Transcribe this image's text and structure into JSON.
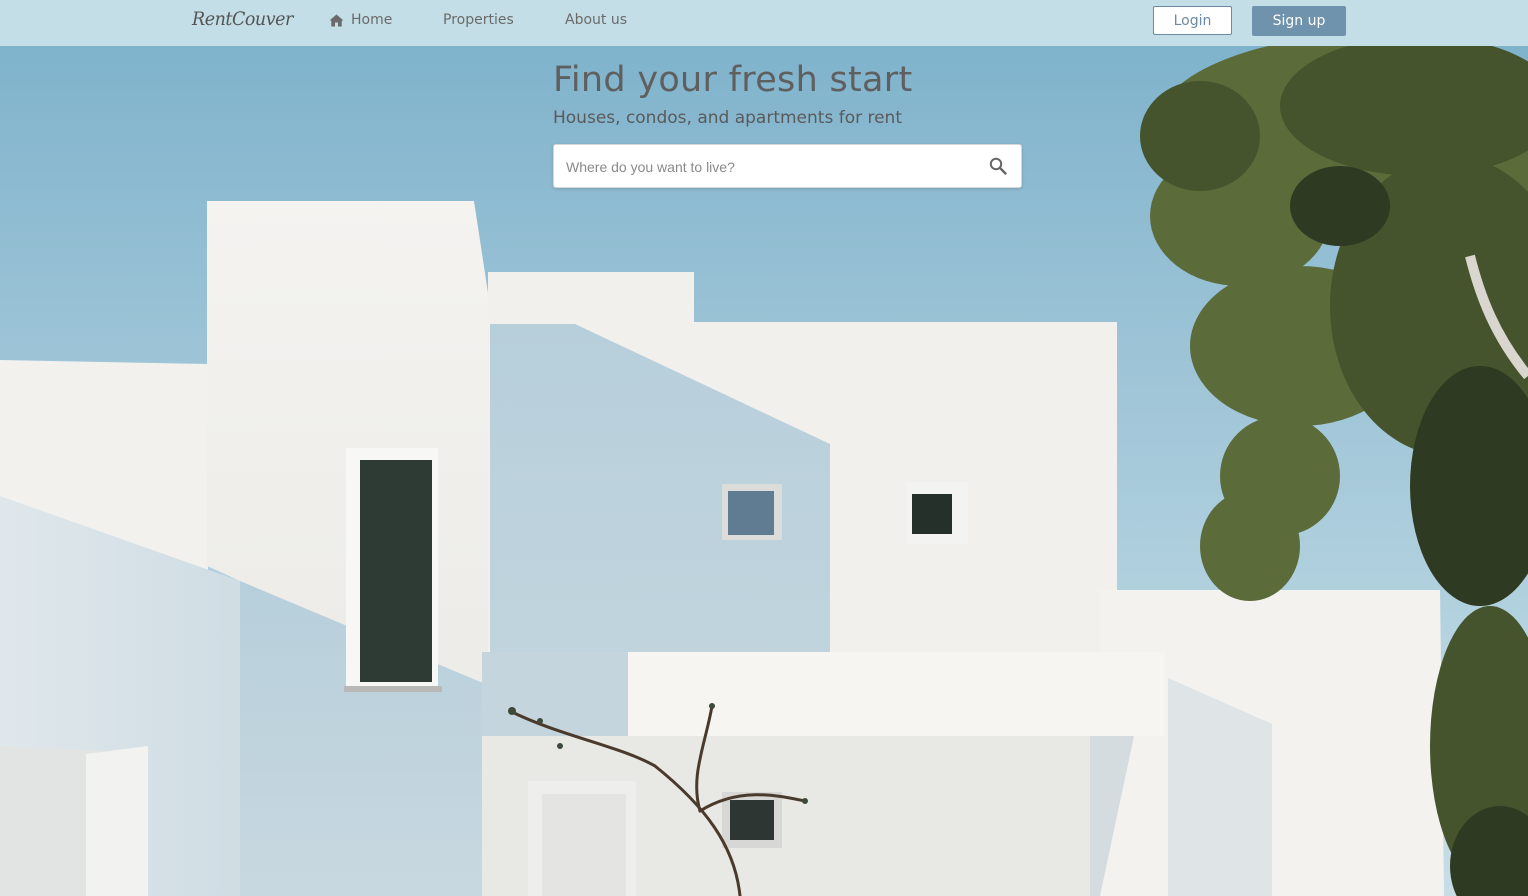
{
  "brand": {
    "logo_text": "RentCouver"
  },
  "nav": {
    "items": [
      {
        "label": "Home",
        "icon": "home-icon"
      },
      {
        "label": "Properties"
      },
      {
        "label": "About us"
      }
    ],
    "login_label": "Login",
    "signup_label": "Sign up"
  },
  "hero": {
    "title": "Find your fresh start",
    "subtitle": "Houses, condos, and apartments for rent",
    "search": {
      "placeholder": "Where do you want to live?",
      "value": "",
      "icon": "search-icon"
    }
  },
  "colors": {
    "navbar_bg": "#c3dee6",
    "signup_bg": "#6f93ad",
    "login_border": "#6b8aa3",
    "sky": "#8dbcd2"
  }
}
